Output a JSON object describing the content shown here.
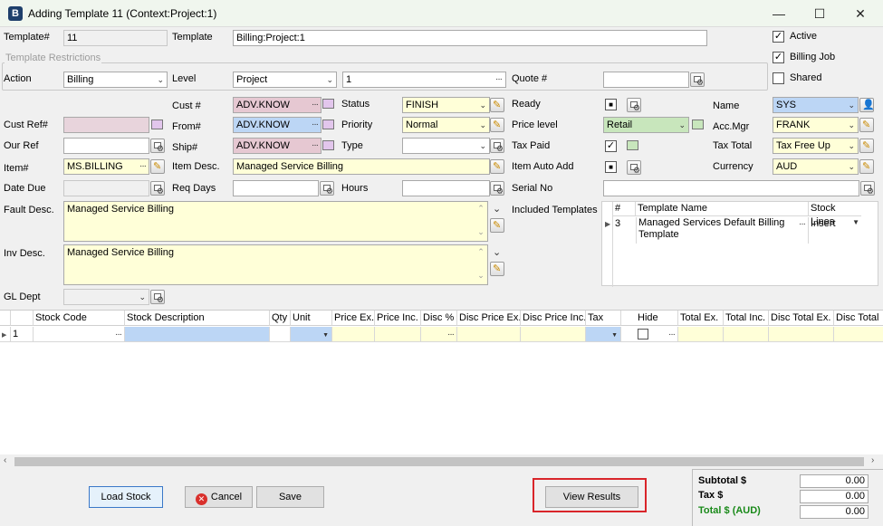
{
  "window": {
    "title": "Adding Template 11 (Context:Project:1)",
    "app_icon_letter": "B",
    "minimize": "—",
    "maximize": "☐",
    "close": "✕"
  },
  "header": {
    "template_num_label": "Template#",
    "template_num": "11",
    "template_label": "Template",
    "template_value": "Billing:Project:1",
    "active_label": "Active",
    "billing_job_label": "Billing Job",
    "shared_label": "Shared"
  },
  "restrictions": {
    "section_label": "Template Restrictions",
    "action_label": "Action",
    "action_value": "Billing",
    "level_label": "Level",
    "level_value": "Project",
    "level_num": "1",
    "quote_label": "Quote #",
    "quote_value": ""
  },
  "form": {
    "cust_label": "Cust #",
    "cust_value": "ADV.KNOW",
    "status_label": "Status",
    "status_value": "FINISH",
    "ready_label": "Ready",
    "name_label": "Name",
    "name_value": "SYS",
    "custref_label": "Cust Ref#",
    "custref_value": "",
    "from_label": "From#",
    "from_value": "ADV.KNOW",
    "priority_label": "Priority",
    "priority_value": "Normal",
    "pricelevel_label": "Price level",
    "pricelevel_value": "Retail",
    "accmgr_label": "Acc.Mgr",
    "accmgr_value": "FRANK",
    "ourref_label": "Our Ref",
    "ourref_value": "",
    "ship_label": "Ship#",
    "ship_value": "ADV.KNOW",
    "type_label": "Type",
    "type_value": "",
    "taxpaid_label": "Tax Paid",
    "taxtotal_label": "Tax Total",
    "taxtotal_value": "Tax Free Up",
    "item_label": "Item#",
    "item_value": "MS.BILLING",
    "itemdesc_label": "Item Desc.",
    "itemdesc_value": "Managed Service Billing",
    "itemautoadd_label": "Item Auto Add",
    "currency_label": "Currency",
    "currency_value": "AUD",
    "datedue_label": "Date Due",
    "datedue_value": "",
    "reqdays_label": "Req Days",
    "reqdays_value": "",
    "hours_label": "Hours",
    "hours_value": "",
    "serial_label": "Serial No",
    "serial_value": "",
    "faultdesc_label": "Fault Desc.",
    "faultdesc_value": "Managed Service Billing",
    "invdesc_label": "Inv Desc.",
    "invdesc_value": "Managed Service Billing",
    "gldept_label": "GL Dept",
    "gldept_value": "",
    "included_label": "Included Templates"
  },
  "included_templates": {
    "headers": [
      "#",
      "Template Name",
      "Stock Lines"
    ],
    "rows": [
      {
        "num": "3",
        "name": "Managed Services Default Billing Template",
        "stock": "Insert"
      }
    ]
  },
  "grid": {
    "headers": [
      "Stock Code",
      "Stock Description",
      "Qty",
      "Unit",
      "Price Ex.",
      "Price Inc.",
      "Disc %",
      "Disc Price Ex.",
      "Disc Price Inc.",
      "Tax",
      "Hide",
      "Total Ex.",
      "Total Inc.",
      "Disc Total Ex.",
      "Disc Total"
    ],
    "row_num": "1"
  },
  "buttons": {
    "load_stock": "Load Stock",
    "cancel": "Cancel",
    "save": "Save",
    "view_results": "View Results"
  },
  "totals": {
    "subtotal_label": "Subtotal $",
    "subtotal": "0.00",
    "tax_label": "Tax $",
    "tax": "0.00",
    "total_label": "Total $ (AUD)",
    "total": "0.00"
  },
  "colors": {
    "total_label": "#1a8a1a",
    "highlight_box": "#d9252a"
  }
}
